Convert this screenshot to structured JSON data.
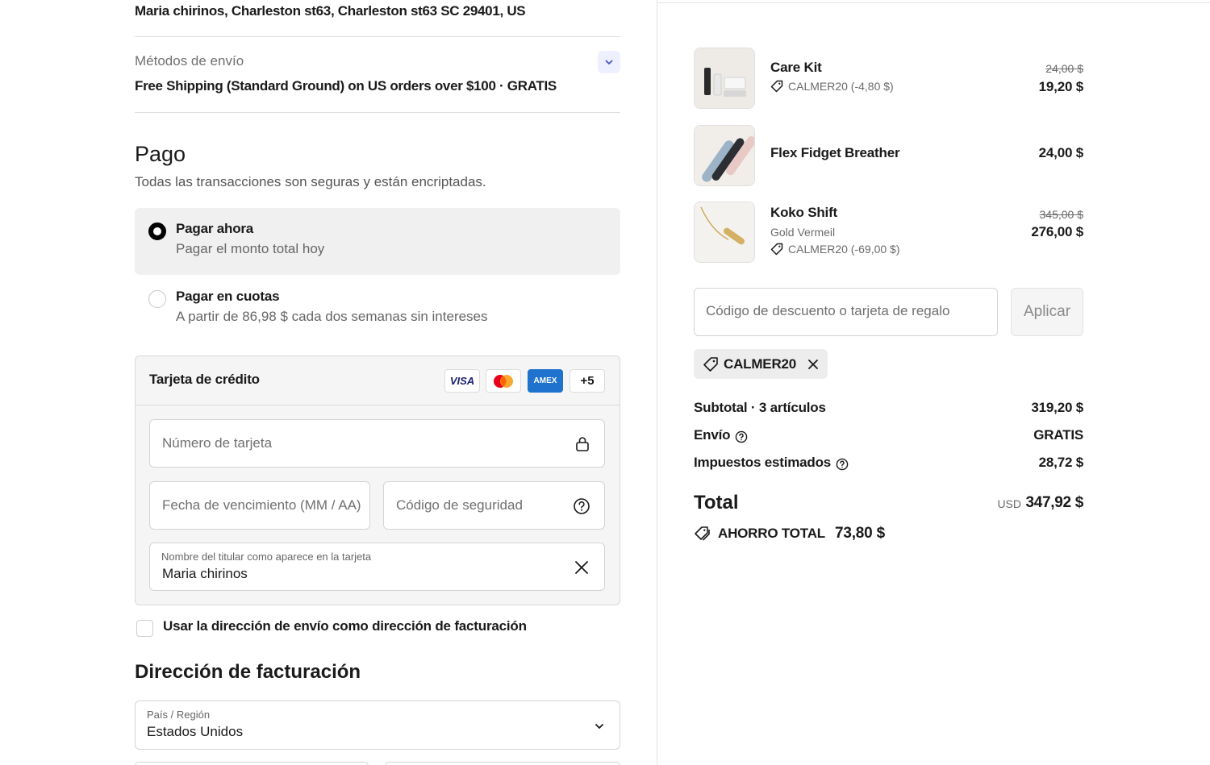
{
  "contact": {
    "address": "Maria chirinos, Charleston st63, Charleston st63 SC 29401, US"
  },
  "shipping": {
    "label": "Métodos de envío",
    "value": "Free Shipping (Standard Ground) on US orders over $100 · GRATIS",
    "toggle_icon": "chevron-down-icon"
  },
  "payment": {
    "title": "Pago",
    "subtitle": "Todas las transacciones son seguras y están encriptadas.",
    "options": [
      {
        "title": "Pagar ahora",
        "subtitle": "Pagar el monto total hoy",
        "selected": true
      },
      {
        "title": "Pagar en cuotas",
        "subtitle": "A partir de 86,98 $ cada dos semanas sin intereses",
        "selected": false
      }
    ],
    "card": {
      "title": "Tarjeta de crédito",
      "brands": [
        "VISA",
        "mastercard",
        "AMEX",
        "+5"
      ],
      "number_placeholder": "Número de tarjeta",
      "expiry_placeholder": "Fecha de vencimiento (MM / AA)",
      "cvc_placeholder": "Código de seguridad",
      "holder_label": "Nombre del titular como aparece en la tarjeta",
      "holder_value": "Maria chirinos"
    },
    "same_address_label": "Usar la dirección de envío como dirección de facturación"
  },
  "billing": {
    "title": "Dirección de facturación",
    "country_label": "País / Región",
    "country_value": "Estados Unidos"
  },
  "summary": {
    "items": [
      {
        "name": "Care Kit",
        "variant": "",
        "discount": "CALMER20 (-4,80 $)",
        "old_price": "24,00 $",
        "price": "19,20 $"
      },
      {
        "name": "Flex Fidget Breather",
        "variant": "",
        "discount": "",
        "old_price": "",
        "price": "24,00 $"
      },
      {
        "name": "Koko Shift",
        "variant": "Gold Vermeil",
        "discount": "CALMER20 (-69,00 $)",
        "old_price": "345,00 $",
        "price": "276,00 $"
      }
    ],
    "code_placeholder": "Código de descuento o tarjeta de regalo",
    "apply_label": "Aplicar",
    "applied_code": "CALMER20",
    "subtotal_label": "Subtotal · 3 artículos",
    "subtotal_value": "319,20 $",
    "shipping_label": "Envío",
    "shipping_value": "GRATIS",
    "tax_label": "Impuestos estimados",
    "tax_value": "28,72 $",
    "total_label": "Total",
    "total_currency": "USD",
    "total_value": "347,92 $",
    "savings_label": "AHORRO TOTAL",
    "savings_value": "73,80 $"
  },
  "colors": {
    "accent": "#000000",
    "selected_bg": "#f0f0f0",
    "toggle_bg": "#eef0ff",
    "amex_blue": "#1f72cd"
  }
}
